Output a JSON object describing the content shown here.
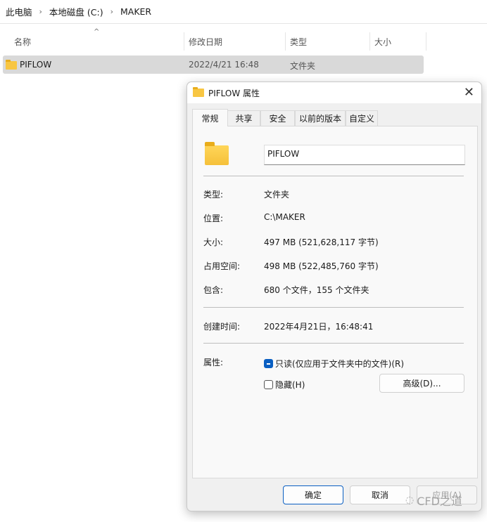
{
  "breadcrumb": [
    "此电脑",
    "本地磁盘 (C:)",
    "MAKER"
  ],
  "columns": {
    "name": "名称",
    "modified": "修改日期",
    "type": "类型",
    "size": "大小"
  },
  "file_row": {
    "name": "PIFLOW",
    "modified": "2022/4/21 16:48",
    "type": "文件夹"
  },
  "dialog": {
    "title": "PIFLOW 属性",
    "tabs": [
      "常规",
      "共享",
      "安全",
      "以前的版本",
      "自定义"
    ],
    "name_value": "PIFLOW",
    "fields": [
      {
        "label": "类型:",
        "value": "文件夹"
      },
      {
        "label": "位置:",
        "value": "C:\\MAKER"
      },
      {
        "label": "大小:",
        "value": "497 MB (521,628,117 字节)"
      },
      {
        "label": "占用空间:",
        "value": "498 MB (522,485,760 字节)"
      },
      {
        "label": "包含:",
        "value": "680 个文件，155 个文件夹"
      }
    ],
    "created": {
      "label": "创建时间:",
      "value": "2022年4月21日，16:48:41"
    },
    "attributes": {
      "label": "属性:",
      "readonly": "只读(仅应用于文件夹中的文件)(R)",
      "hidden": "隐藏(H)",
      "advanced": "高级(D)..."
    },
    "buttons": {
      "ok": "确定",
      "cancel": "取消",
      "apply": "应用(A)"
    }
  },
  "watermark": "CFD之道",
  "colors": {
    "accent": "#0a5fc2",
    "selection": "#d9d9d9"
  }
}
